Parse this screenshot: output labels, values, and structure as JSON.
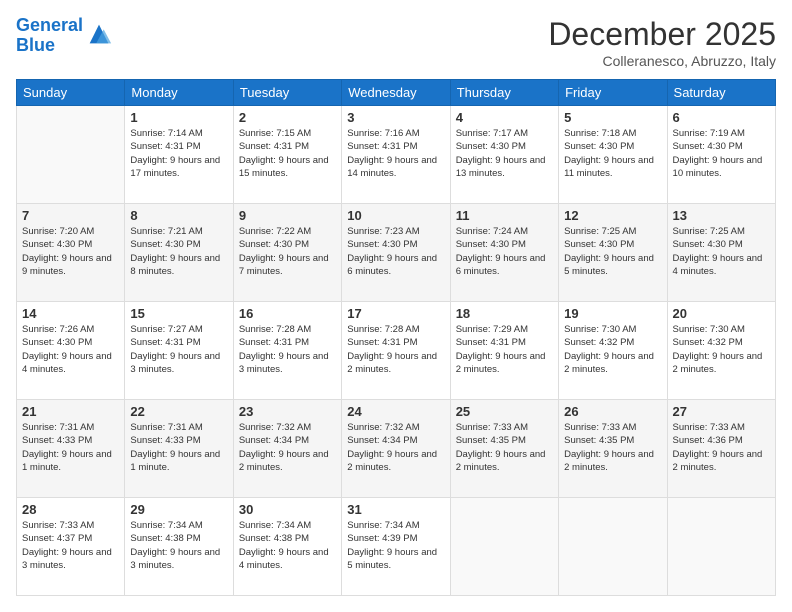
{
  "logo": {
    "line1": "General",
    "line2": "Blue"
  },
  "title": "December 2025",
  "subtitle": "Colleranesco, Abruzzo, Italy",
  "weekdays": [
    "Sunday",
    "Monday",
    "Tuesday",
    "Wednesday",
    "Thursday",
    "Friday",
    "Saturday"
  ],
  "weeks": [
    [
      {
        "day": "",
        "sunrise": "",
        "sunset": "",
        "daylight": ""
      },
      {
        "day": "1",
        "sunrise": "Sunrise: 7:14 AM",
        "sunset": "Sunset: 4:31 PM",
        "daylight": "Daylight: 9 hours and 17 minutes."
      },
      {
        "day": "2",
        "sunrise": "Sunrise: 7:15 AM",
        "sunset": "Sunset: 4:31 PM",
        "daylight": "Daylight: 9 hours and 15 minutes."
      },
      {
        "day": "3",
        "sunrise": "Sunrise: 7:16 AM",
        "sunset": "Sunset: 4:31 PM",
        "daylight": "Daylight: 9 hours and 14 minutes."
      },
      {
        "day": "4",
        "sunrise": "Sunrise: 7:17 AM",
        "sunset": "Sunset: 4:30 PM",
        "daylight": "Daylight: 9 hours and 13 minutes."
      },
      {
        "day": "5",
        "sunrise": "Sunrise: 7:18 AM",
        "sunset": "Sunset: 4:30 PM",
        "daylight": "Daylight: 9 hours and 11 minutes."
      },
      {
        "day": "6",
        "sunrise": "Sunrise: 7:19 AM",
        "sunset": "Sunset: 4:30 PM",
        "daylight": "Daylight: 9 hours and 10 minutes."
      }
    ],
    [
      {
        "day": "7",
        "sunrise": "Sunrise: 7:20 AM",
        "sunset": "Sunset: 4:30 PM",
        "daylight": "Daylight: 9 hours and 9 minutes."
      },
      {
        "day": "8",
        "sunrise": "Sunrise: 7:21 AM",
        "sunset": "Sunset: 4:30 PM",
        "daylight": "Daylight: 9 hours and 8 minutes."
      },
      {
        "day": "9",
        "sunrise": "Sunrise: 7:22 AM",
        "sunset": "Sunset: 4:30 PM",
        "daylight": "Daylight: 9 hours and 7 minutes."
      },
      {
        "day": "10",
        "sunrise": "Sunrise: 7:23 AM",
        "sunset": "Sunset: 4:30 PM",
        "daylight": "Daylight: 9 hours and 6 minutes."
      },
      {
        "day": "11",
        "sunrise": "Sunrise: 7:24 AM",
        "sunset": "Sunset: 4:30 PM",
        "daylight": "Daylight: 9 hours and 6 minutes."
      },
      {
        "day": "12",
        "sunrise": "Sunrise: 7:25 AM",
        "sunset": "Sunset: 4:30 PM",
        "daylight": "Daylight: 9 hours and 5 minutes."
      },
      {
        "day": "13",
        "sunrise": "Sunrise: 7:25 AM",
        "sunset": "Sunset: 4:30 PM",
        "daylight": "Daylight: 9 hours and 4 minutes."
      }
    ],
    [
      {
        "day": "14",
        "sunrise": "Sunrise: 7:26 AM",
        "sunset": "Sunset: 4:30 PM",
        "daylight": "Daylight: 9 hours and 4 minutes."
      },
      {
        "day": "15",
        "sunrise": "Sunrise: 7:27 AM",
        "sunset": "Sunset: 4:31 PM",
        "daylight": "Daylight: 9 hours and 3 minutes."
      },
      {
        "day": "16",
        "sunrise": "Sunrise: 7:28 AM",
        "sunset": "Sunset: 4:31 PM",
        "daylight": "Daylight: 9 hours and 3 minutes."
      },
      {
        "day": "17",
        "sunrise": "Sunrise: 7:28 AM",
        "sunset": "Sunset: 4:31 PM",
        "daylight": "Daylight: 9 hours and 2 minutes."
      },
      {
        "day": "18",
        "sunrise": "Sunrise: 7:29 AM",
        "sunset": "Sunset: 4:31 PM",
        "daylight": "Daylight: 9 hours and 2 minutes."
      },
      {
        "day": "19",
        "sunrise": "Sunrise: 7:30 AM",
        "sunset": "Sunset: 4:32 PM",
        "daylight": "Daylight: 9 hours and 2 minutes."
      },
      {
        "day": "20",
        "sunrise": "Sunrise: 7:30 AM",
        "sunset": "Sunset: 4:32 PM",
        "daylight": "Daylight: 9 hours and 2 minutes."
      }
    ],
    [
      {
        "day": "21",
        "sunrise": "Sunrise: 7:31 AM",
        "sunset": "Sunset: 4:33 PM",
        "daylight": "Daylight: 9 hours and 1 minute."
      },
      {
        "day": "22",
        "sunrise": "Sunrise: 7:31 AM",
        "sunset": "Sunset: 4:33 PM",
        "daylight": "Daylight: 9 hours and 1 minute."
      },
      {
        "day": "23",
        "sunrise": "Sunrise: 7:32 AM",
        "sunset": "Sunset: 4:34 PM",
        "daylight": "Daylight: 9 hours and 2 minutes."
      },
      {
        "day": "24",
        "sunrise": "Sunrise: 7:32 AM",
        "sunset": "Sunset: 4:34 PM",
        "daylight": "Daylight: 9 hours and 2 minutes."
      },
      {
        "day": "25",
        "sunrise": "Sunrise: 7:33 AM",
        "sunset": "Sunset: 4:35 PM",
        "daylight": "Daylight: 9 hours and 2 minutes."
      },
      {
        "day": "26",
        "sunrise": "Sunrise: 7:33 AM",
        "sunset": "Sunset: 4:35 PM",
        "daylight": "Daylight: 9 hours and 2 minutes."
      },
      {
        "day": "27",
        "sunrise": "Sunrise: 7:33 AM",
        "sunset": "Sunset: 4:36 PM",
        "daylight": "Daylight: 9 hours and 2 minutes."
      }
    ],
    [
      {
        "day": "28",
        "sunrise": "Sunrise: 7:33 AM",
        "sunset": "Sunset: 4:37 PM",
        "daylight": "Daylight: 9 hours and 3 minutes."
      },
      {
        "day": "29",
        "sunrise": "Sunrise: 7:34 AM",
        "sunset": "Sunset: 4:38 PM",
        "daylight": "Daylight: 9 hours and 3 minutes."
      },
      {
        "day": "30",
        "sunrise": "Sunrise: 7:34 AM",
        "sunset": "Sunset: 4:38 PM",
        "daylight": "Daylight: 9 hours and 4 minutes."
      },
      {
        "day": "31",
        "sunrise": "Sunrise: 7:34 AM",
        "sunset": "Sunset: 4:39 PM",
        "daylight": "Daylight: 9 hours and 5 minutes."
      },
      {
        "day": "",
        "sunrise": "",
        "sunset": "",
        "daylight": ""
      },
      {
        "day": "",
        "sunrise": "",
        "sunset": "",
        "daylight": ""
      },
      {
        "day": "",
        "sunrise": "",
        "sunset": "",
        "daylight": ""
      }
    ]
  ]
}
